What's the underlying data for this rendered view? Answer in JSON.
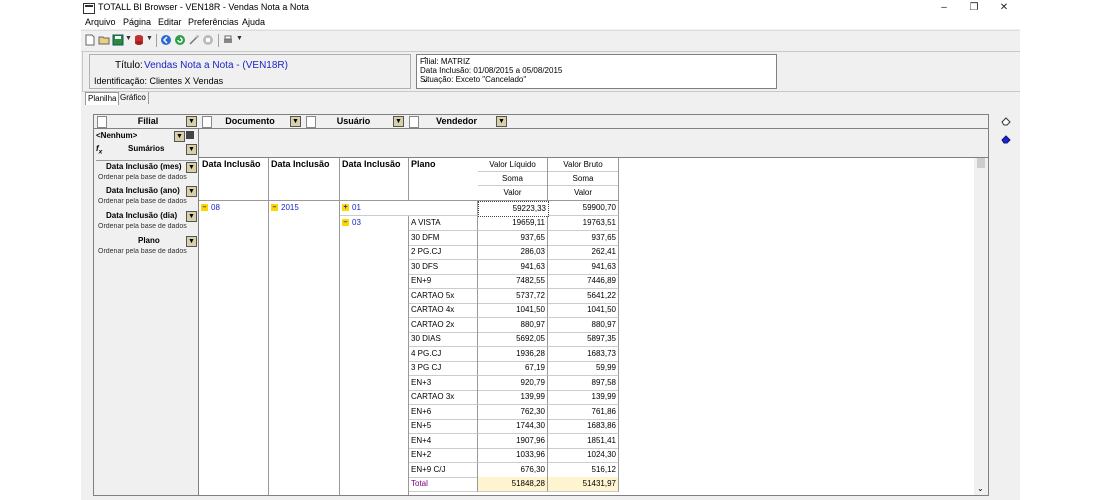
{
  "window": {
    "title": "TOTALL BI Browser - VEN18R - Vendas Nota a Nota"
  },
  "menu": [
    "Arquivo",
    "Página",
    "Editar",
    "Preferências",
    "Ajuda"
  ],
  "info": {
    "titulo_label": "Título:",
    "titulo_value": "Vendas Nota a Nota - (VEN18R)",
    "identificacao": "Identificação: Clientes X Vendas",
    "filter_lines": [
      "Filial: MATRIZ",
      "Data Inclusão: 01/08/2015 a 05/08/2015",
      "Situação: Exceto \"Cancelado\""
    ]
  },
  "tabs": [
    "Planilha",
    "Gráfico"
  ],
  "colbar": {
    "filial": "Filial",
    "documento": "Documento",
    "usuario": "Usuário",
    "vendedor": "Vendedor"
  },
  "rowbar": {
    "nenhum": "<Nenhum>",
    "sumarios": "Sumários",
    "dims": [
      {
        "label": "Data Inclusão (mes)",
        "sub": "Ordenar pela base de dados"
      },
      {
        "label": "Data Inclusão (ano)",
        "sub": "Ordenar pela base de dados"
      },
      {
        "label": "Data Inclusão (dia)",
        "sub": "Ordenar pela base de dados"
      },
      {
        "label": "Plano",
        "sub": "Ordenar pela base de dados"
      }
    ]
  },
  "grid": {
    "row_headers": [
      "Data Inclusão",
      "Data Inclusão",
      "Data Inclusão",
      "Plano"
    ],
    "measures": [
      {
        "name": "Valor Líquido",
        "agg": "Soma",
        "field": "Valor"
      },
      {
        "name": "Valor Bruto",
        "agg": "Soma",
        "field": "Valor"
      }
    ],
    "mes": "08",
    "ano": "2015",
    "dia_top": "01",
    "dia_sub": "03",
    "top_values": [
      "59223,33",
      "59900,70"
    ],
    "rows": [
      {
        "plano": "A VISTA",
        "liquido": "19659,11",
        "bruto": "19763,51"
      },
      {
        "plano": "30 DFM",
        "liquido": "937,65",
        "bruto": "937,65"
      },
      {
        "plano": "2 PG.CJ",
        "liquido": "286,03",
        "bruto": "262,41"
      },
      {
        "plano": "30 DFS",
        "liquido": "941,63",
        "bruto": "941,63"
      },
      {
        "plano": "EN+9",
        "liquido": "7482,55",
        "bruto": "7446,89"
      },
      {
        "plano": "CARTAO 5x",
        "liquido": "5737,72",
        "bruto": "5641,22"
      },
      {
        "plano": "CARTAO 4x",
        "liquido": "1041,50",
        "bruto": "1041,50"
      },
      {
        "plano": "CARTAO 2x",
        "liquido": "880,97",
        "bruto": "880,97"
      },
      {
        "plano": "30 DIAS",
        "liquido": "5692,05",
        "bruto": "5897,35"
      },
      {
        "plano": "4 PG.CJ",
        "liquido": "1936,28",
        "bruto": "1683,73"
      },
      {
        "plano": "3 PG CJ",
        "liquido": "67,19",
        "bruto": "59,99"
      },
      {
        "plano": "EN+3",
        "liquido": "920,79",
        "bruto": "897,58"
      },
      {
        "plano": "CARTAO 3x",
        "liquido": "139,99",
        "bruto": "139,99"
      },
      {
        "plano": "EN+6",
        "liquido": "762,30",
        "bruto": "761,86"
      },
      {
        "plano": "EN+5",
        "liquido": "1744,30",
        "bruto": "1683,86"
      },
      {
        "plano": "EN+4",
        "liquido": "1907,96",
        "bruto": "1851,41"
      },
      {
        "plano": "EN+2",
        "liquido": "1033,96",
        "bruto": "1024,30"
      },
      {
        "plano": "EN+9 C/J",
        "liquido": "676,30",
        "bruto": "516,12"
      }
    ],
    "total": {
      "label": "Total",
      "liquido": "51848,28",
      "bruto": "51431,97"
    }
  },
  "colors": {
    "accent_blue": "#1a24c8",
    "total_bg": "#fff4d0",
    "total_text": "#800080"
  }
}
